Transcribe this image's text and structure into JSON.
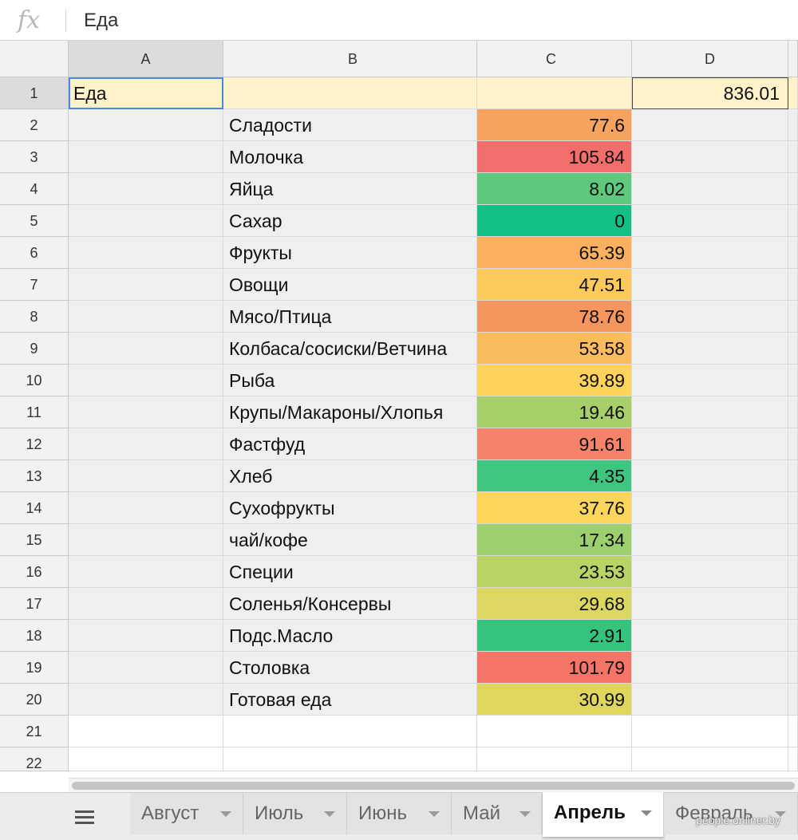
{
  "formula_bar": {
    "fx_label": "fx",
    "value": "Еда"
  },
  "columns": [
    "A",
    "B",
    "C",
    "D"
  ],
  "row1": {
    "number": "1",
    "a": "Еда",
    "d": "836.01"
  },
  "rows": [
    {
      "number": "2",
      "label": "Сладости",
      "value": "77.6",
      "color": "#f6a35f"
    },
    {
      "number": "3",
      "label": "Молочка",
      "value": "105.84",
      "color": "#f26e6a"
    },
    {
      "number": "4",
      "label": "Яйца",
      "value": "8.02",
      "color": "#5ec97c"
    },
    {
      "number": "5",
      "label": "Сахар",
      "value": "0",
      "color": "#14c184"
    },
    {
      "number": "6",
      "label": "Фрукты",
      "value": "65.39",
      "color": "#fbb05f"
    },
    {
      "number": "7",
      "label": "Овощи",
      "value": "47.51",
      "color": "#fcca5c"
    },
    {
      "number": "8",
      "label": "Мясо/Птица",
      "value": "78.76",
      "color": "#f5965f"
    },
    {
      "number": "9",
      "label": "Колбаса/сосиски/Ветчина",
      "value": "53.58",
      "color": "#fbbc5d"
    },
    {
      "number": "10",
      "label": "Рыба",
      "value": "39.89",
      "color": "#fdd35b"
    },
    {
      "number": "11",
      "label": "Крупы/Макароны/Хлопья",
      "value": "19.46",
      "color": "#a7d06a"
    },
    {
      "number": "12",
      "label": "Фастфуд",
      "value": "91.61",
      "color": "#f4836a"
    },
    {
      "number": "13",
      "label": "Хлеб",
      "value": "4.35",
      "color": "#3fc57f"
    },
    {
      "number": "14",
      "label": "Сухофрукты",
      "value": "37.76",
      "color": "#fcd65a"
    },
    {
      "number": "15",
      "label": "чай/кофе",
      "value": "17.34",
      "color": "#9ccf6e"
    },
    {
      "number": "16",
      "label": "Специи",
      "value": "23.53",
      "color": "#b9d365"
    },
    {
      "number": "17",
      "label": "Соленья/Консервы",
      "value": "29.68",
      "color": "#dcd762"
    },
    {
      "number": "18",
      "label": "Подс.Масло",
      "value": "2.91",
      "color": "#36c37e"
    },
    {
      "number": "19",
      "label": "Столовка",
      "value": "101.79",
      "color": "#f47468"
    },
    {
      "number": "20",
      "label": "Готовая еда",
      "value": "30.99",
      "color": "#dfd65e"
    }
  ],
  "empty_rows": [
    "21",
    "22"
  ],
  "tabs": [
    {
      "label": "Август",
      "active": false
    },
    {
      "label": "Июль",
      "active": false
    },
    {
      "label": "Июнь",
      "active": false
    },
    {
      "label": "Май",
      "active": false
    },
    {
      "label": "Апрель",
      "active": true
    },
    {
      "label": "Февраль",
      "active": false
    }
  ],
  "watermark": "people.onliner.by"
}
